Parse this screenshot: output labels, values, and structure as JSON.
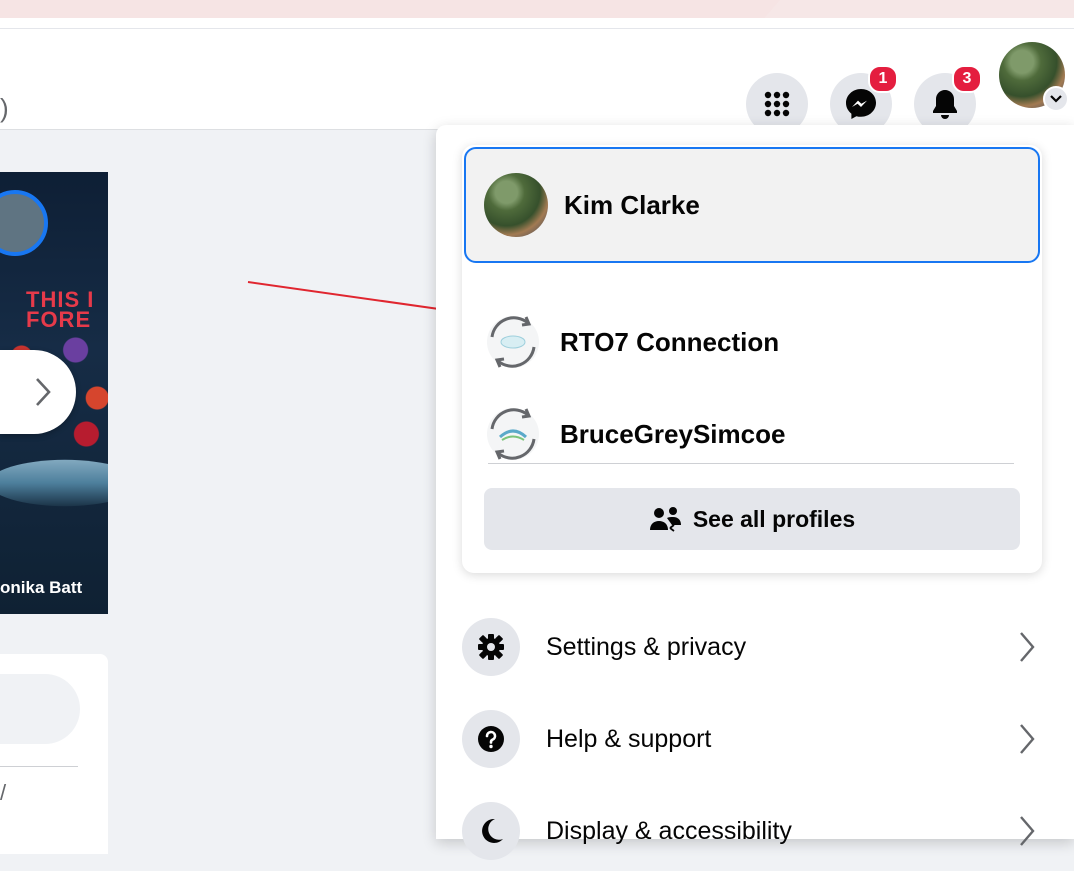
{
  "topbar": {
    "search_fragment": ")",
    "messenger_badge": "1",
    "notifications_badge": "3"
  },
  "story": {
    "banner_text": "THIS I\nFORE",
    "owner_name": "onika Batt"
  },
  "left_panel": {
    "fragment": "/"
  },
  "profiles": {
    "current": "Kim Clarke",
    "items": [
      {
        "label": "RTO7 Connection"
      },
      {
        "label": "BruceGreySimcoe"
      }
    ],
    "see_all_label": "See all profiles"
  },
  "menu": {
    "items": [
      {
        "label": "Settings & privacy",
        "icon": "gear-icon"
      },
      {
        "label": "Help & support",
        "icon": "question-icon"
      },
      {
        "label": "Display & accessibility",
        "icon": "moon-icon"
      }
    ]
  },
  "colors": {
    "accent": "#1877f2",
    "badge": "#e41e3f",
    "annotation_arrow": "#e0262f",
    "surface": "#e4e6eb"
  }
}
